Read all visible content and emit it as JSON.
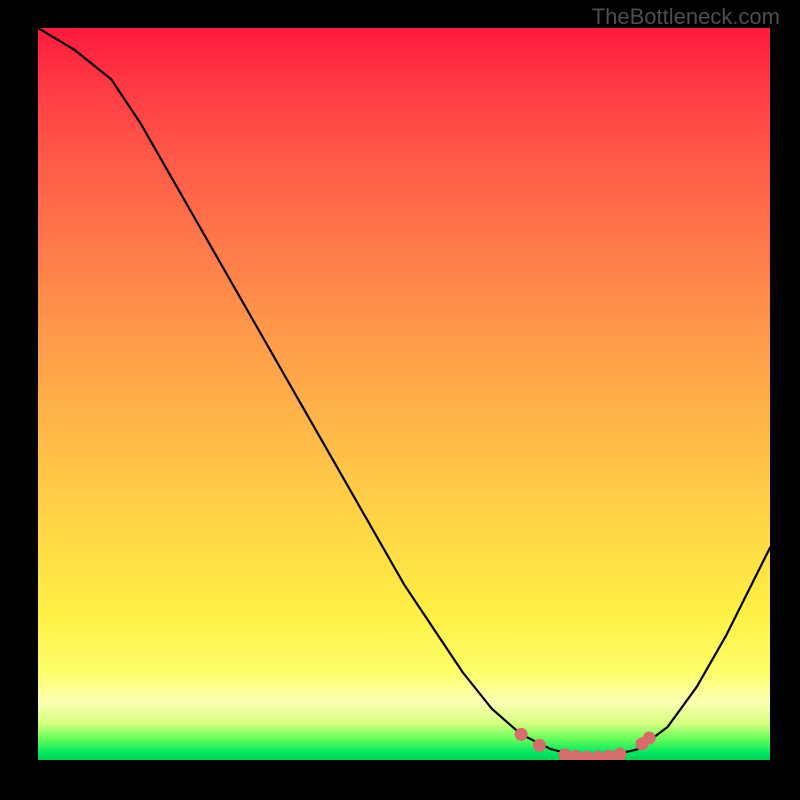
{
  "watermark_text": "TheBottleneck.com",
  "chart_data": {
    "type": "line",
    "title": "",
    "xlabel": "",
    "ylabel": "",
    "x_range": [
      0,
      1
    ],
    "y_range": [
      0,
      1
    ],
    "curve_points": [
      {
        "x": 0.0,
        "y": 1.0
      },
      {
        "x": 0.05,
        "y": 0.97
      },
      {
        "x": 0.1,
        "y": 0.93
      },
      {
        "x": 0.14,
        "y": 0.87
      },
      {
        "x": 0.18,
        "y": 0.8
      },
      {
        "x": 0.22,
        "y": 0.73
      },
      {
        "x": 0.26,
        "y": 0.66
      },
      {
        "x": 0.3,
        "y": 0.59
      },
      {
        "x": 0.34,
        "y": 0.52
      },
      {
        "x": 0.38,
        "y": 0.45
      },
      {
        "x": 0.42,
        "y": 0.38
      },
      {
        "x": 0.46,
        "y": 0.31
      },
      {
        "x": 0.5,
        "y": 0.24
      },
      {
        "x": 0.54,
        "y": 0.18
      },
      {
        "x": 0.58,
        "y": 0.12
      },
      {
        "x": 0.62,
        "y": 0.07
      },
      {
        "x": 0.66,
        "y": 0.035
      },
      {
        "x": 0.7,
        "y": 0.015
      },
      {
        "x": 0.74,
        "y": 0.005
      },
      {
        "x": 0.78,
        "y": 0.005
      },
      {
        "x": 0.82,
        "y": 0.015
      },
      {
        "x": 0.86,
        "y": 0.045
      },
      {
        "x": 0.9,
        "y": 0.1
      },
      {
        "x": 0.94,
        "y": 0.17
      },
      {
        "x": 0.98,
        "y": 0.25
      },
      {
        "x": 1.0,
        "y": 0.29
      }
    ],
    "highlight_points": [
      {
        "x": 0.66,
        "y": 0.035
      },
      {
        "x": 0.685,
        "y": 0.02
      },
      {
        "x": 0.72,
        "y": 0.007
      },
      {
        "x": 0.735,
        "y": 0.005
      },
      {
        "x": 0.75,
        "y": 0.004
      },
      {
        "x": 0.765,
        "y": 0.004
      },
      {
        "x": 0.78,
        "y": 0.005
      },
      {
        "x": 0.795,
        "y": 0.008
      },
      {
        "x": 0.825,
        "y": 0.022
      },
      {
        "x": 0.835,
        "y": 0.03
      }
    ],
    "highlight_color": "#d86b6b",
    "curve_color": "#000000",
    "gradient_stops": [
      {
        "pos": 0.0,
        "color": "#ff1a3d"
      },
      {
        "pos": 0.5,
        "color": "#ffaa48"
      },
      {
        "pos": 0.85,
        "color": "#fff244"
      },
      {
        "pos": 0.97,
        "color": "#6dff5a"
      },
      {
        "pos": 1.0,
        "color": "#00d458"
      }
    ]
  }
}
